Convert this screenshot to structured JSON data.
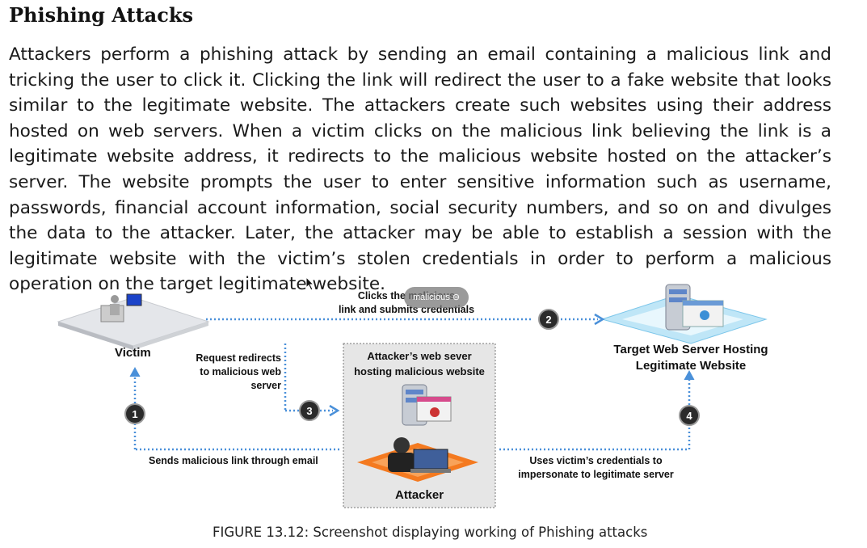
{
  "document": {
    "title": "Phishing Attacks",
    "paragraph": "Attackers perform a phishing attack by sending an email containing a malicious link and tricking the user to click it. Clicking the link will redirect the user to a fake website that looks similar to the legitimate website. The attackers create such websites using their address hosted on web servers. When a victim clicks on the malicious link believing the link is a legitimate website address, it redirects to the malicious website hosted on the attacker’s server. The website prompts the user to enter sensitive information such as username, passwords, financial account information, social security numbers, and so on and divulges the data to the attacker. Later, the attacker may be able to establish a session with the legitimate website with the victim’s stolen credentials in order to perform a malicious operation on the target legitimate website.",
    "caption": "FIGURE 13.12: Screenshot displaying working of Phishing attacks"
  },
  "diagram": {
    "victim_label": "Victim",
    "target_label_line1": "Target Web Server Hosting",
    "target_label_line2": "Legitimate Website",
    "attacker_server_line1": "Attacker’s web sever",
    "attacker_server_line2": "hosting malicious website",
    "attacker_label": "Attacker",
    "clicks_line1": "Clicks the malicious",
    "clicks_line2": "link and submits credentials",
    "redirect_line1": "Request redirects",
    "redirect_line2": "to malicious web",
    "redirect_line3": "server",
    "sends_label": "Sends malicious link through email",
    "uses_line1": "Uses victim’s credentials to",
    "uses_line2": "impersonate to legitimate server",
    "steps": [
      "1",
      "2",
      "3",
      "4"
    ]
  },
  "overlay": {
    "tooltip_text": "malicious ⊖"
  },
  "colors": {
    "arrow_blue": "#4a90d9",
    "platform_gray": "#e4e6ea",
    "platform_blue": "#bfe6f7",
    "attacker_orange": "#f47a20",
    "box_bg": "#e6e6e6",
    "step_circle": "#2b2b2b"
  }
}
